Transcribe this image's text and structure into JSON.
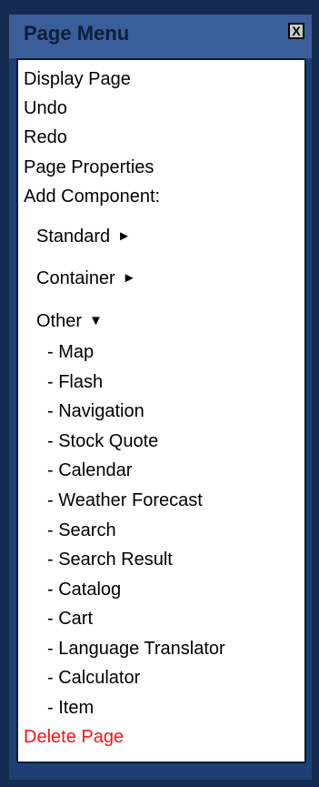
{
  "panel": {
    "title": "Page Menu",
    "close_glyph": "X"
  },
  "menu": {
    "display_page": "Display Page",
    "undo": "Undo",
    "redo": "Redo",
    "page_properties": "Page Properties",
    "add_component": "Add Component:",
    "standard": {
      "label": "Standard",
      "arrow": "►"
    },
    "container": {
      "label": "Container",
      "arrow": "►"
    },
    "other": {
      "label": "Other",
      "arrow": "▼"
    },
    "other_items": [
      "- Map",
      "- Flash",
      "- Navigation",
      "- Stock Quote",
      "- Calendar",
      "- Weather Forecast",
      "- Search",
      "- Search Result",
      "- Catalog",
      "- Cart",
      "- Language Translator",
      "- Calculator",
      "- Item"
    ],
    "delete_page": "Delete Page"
  },
  "colors": {
    "frame": "#1e3f74",
    "titlebar": "#3a5e9a",
    "title_text": "#0d1d3a",
    "delete_text": "#ff1010"
  }
}
